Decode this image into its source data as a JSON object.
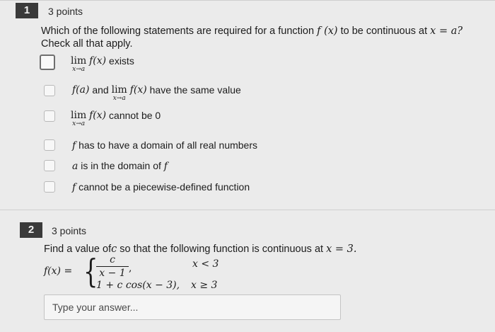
{
  "q1": {
    "number": "1",
    "points": "3 points",
    "prompt_a": "Which of the following statements are required for a function",
    "prompt_fx": "f (x)",
    "prompt_b": "to be continuous at",
    "prompt_xa": "x = a?",
    "prompt_line2": "Check all that apply.",
    "options": {
      "o1": {
        "lim": "lim",
        "sub": "x→a",
        "math": "f(x)",
        "text": "exists"
      },
      "o2": {
        "pre_math": "f(a)",
        "pre_text": "and",
        "lim": "lim",
        "sub": "x→a",
        "math": "f(x)",
        "text": "have the same value"
      },
      "o3": {
        "lim": "lim",
        "sub": "x→a",
        "math": "f(x)",
        "text": "cannot be 0"
      },
      "o4": {
        "math": "f",
        "text": "has to have a domain of all real numbers"
      },
      "o5": {
        "math": "a",
        "text": "is in the domain of",
        "math2": "f"
      },
      "o6": {
        "math": "f",
        "text": "cannot be a piecewise-defined function"
      }
    }
  },
  "q2": {
    "number": "2",
    "points": "3 points",
    "prompt_a": "Find a value of",
    "prompt_c": "c",
    "prompt_b": "so that the following function is continuous at",
    "prompt_x": "x = 3.",
    "fx": "f(x) =",
    "numerator": "c",
    "denominator": "x − 1",
    "comma1": ",",
    "cond1": "x < 3",
    "piece2": "1 + c cos(x − 3),",
    "cond2": "x ≥ 3",
    "answer_placeholder": "Type your answer..."
  }
}
